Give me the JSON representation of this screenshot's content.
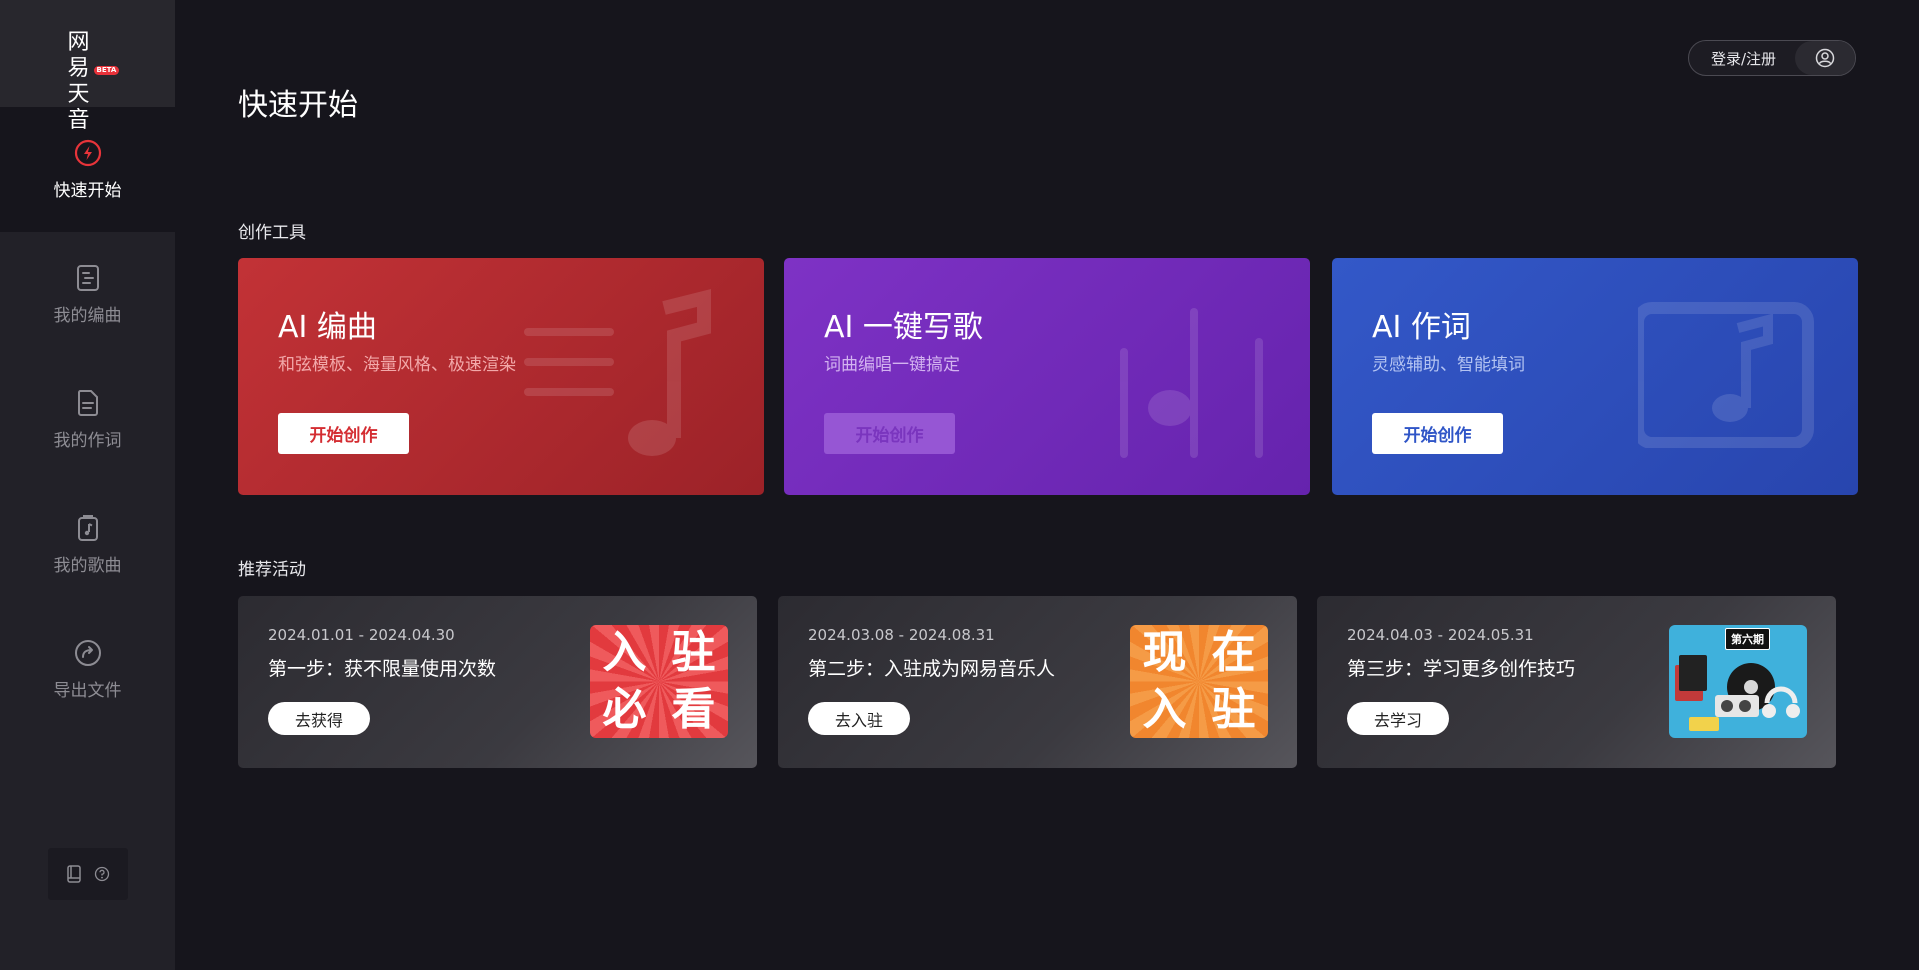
{
  "logo": {
    "text": "网易天音",
    "badge": "BETA"
  },
  "sidebar": {
    "items": [
      {
        "label": "快速开始"
      },
      {
        "label": "我的编曲"
      },
      {
        "label": "我的作词"
      },
      {
        "label": "我的歌曲"
      },
      {
        "label": "导出文件"
      }
    ]
  },
  "header": {
    "title": "快速开始",
    "login_label": "登录/注册"
  },
  "tools": {
    "section_title": "创作工具",
    "cards": [
      {
        "title": "AI 编曲",
        "subtitle": "和弦模板、海量风格、极速渲染",
        "button": "开始创作",
        "color": "#c23236"
      },
      {
        "title": "AI 一键写歌",
        "subtitle": "词曲编唱一键搞定",
        "button": "开始创作",
        "color": "#7e32c5"
      },
      {
        "title": "AI 作词",
        "subtitle": "灵感辅助、智能填词",
        "button": "开始创作",
        "color": "#3358c8"
      }
    ]
  },
  "activities": {
    "section_title": "推荐活动",
    "cards": [
      {
        "date": "2024.01.01 - 2024.04.30",
        "title": "第一步：获不限量使用次数",
        "button": "去获得",
        "thumb_text": [
          "入",
          "驻",
          "必",
          "看"
        ]
      },
      {
        "date": "2024.03.08 - 2024.08.31",
        "title": "第二步：入驻成为网易音乐人",
        "button": "去入驻",
        "thumb_text": [
          "现",
          "在",
          "入",
          "驻"
        ]
      },
      {
        "date": "2024.04.03 - 2024.05.31",
        "title": "第三步：学习更多创作技巧",
        "button": "去学习",
        "thumb_tag": "第六期"
      }
    ]
  }
}
